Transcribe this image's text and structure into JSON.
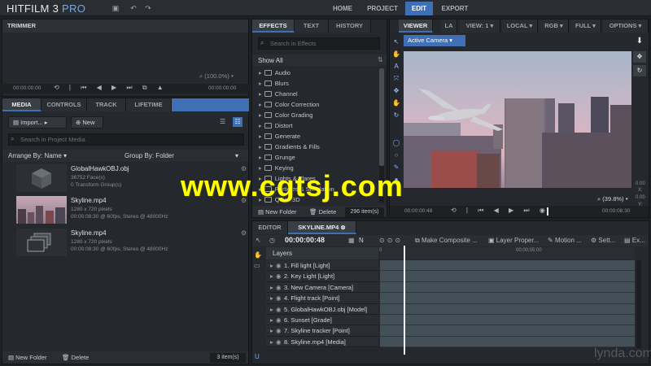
{
  "app": {
    "title": "HITFILM 3",
    "edition": "PRO"
  },
  "nav": {
    "tabs": [
      "HOME",
      "PROJECT",
      "EDIT",
      "EXPORT"
    ],
    "active": "EDIT"
  },
  "trimmer": {
    "title": "TRIMMER",
    "zoom": "(100.0%)",
    "time_start": "00:00:00:00",
    "time_end": "00:00:00:00"
  },
  "media": {
    "tabs": [
      "MEDIA",
      "CONTROLS",
      "TRACK",
      "LIFETIME"
    ],
    "import_label": "Import...",
    "new_label": "New",
    "search_placeholder": "Search in Project Media",
    "arrange_label": "Arrange By: Name",
    "group_label": "Group By: Folder",
    "items": [
      {
        "name": "GlobalHawkOBJ.obj",
        "line1": "36752 Face(s)",
        "line2": "0 Transform Group(s)"
      },
      {
        "name": "Skyline.mp4",
        "line1": "1280 x 720 pixels",
        "line2": "00:00:08:30 @ 60fps, Stereo @ 48000Hz"
      },
      {
        "name": "Skyline.mp4",
        "line1": "1280 x 720 pixels",
        "line2": "00:00:08:30 @ 60fps, Stereo @ 48000Hz"
      }
    ],
    "new_folder": "New Folder",
    "delete": "Delete",
    "count": "3 item(s)"
  },
  "effects": {
    "tabs": [
      "EFFECTS",
      "TEXT",
      "HISTORY"
    ],
    "search_placeholder": "Search in Effects",
    "show_all": "Show All",
    "categories": [
      "Audio",
      "Blurs",
      "Channel",
      "Color Correction",
      "Color Grading",
      "Distort",
      "Generate",
      "Gradients & Fills",
      "Grunge",
      "Keying",
      "Lights & Flares",
      "Particles & Simulation",
      "Quick 3D"
    ],
    "new_folder": "New Folder",
    "delete": "Delete",
    "count": "296 item(s)"
  },
  "viewer": {
    "title": "VIEWER",
    "tab2": "LA",
    "view": "VIEW: 1",
    "space": "LOCAL",
    "color": "RGB",
    "quality": "FULL",
    "options": "OPTIONS",
    "camera": "Active Camera",
    "zoom": "(39.8%)",
    "coord_x_label": "X:",
    "coord_x": "0.00",
    "coord_y_label": "Y:",
    "coord_y": "0.00",
    "time_current": "00:00:00:48",
    "time_end": "00:00:08:30"
  },
  "editor": {
    "tabs": [
      "EDITOR",
      "SKYLINE.MP4"
    ],
    "timecode": "00:00:00:48",
    "tools": [
      "N",
      "Make Composite ...",
      "Layer Proper...",
      "Motion ...",
      "Sett...",
      "Ex..."
    ],
    "ruler": [
      "0",
      "00:00:05:00"
    ],
    "layers_title": "Layers",
    "layers": [
      "1. Fill light [Light]",
      "2. Key Light [Light]",
      "3. New Camera [Camera]",
      "4. Flight track [Point]",
      "5. GlobalHawkOBJ.obj [Model]",
      "6. Sunset [Grade]",
      "7. Skyline tracker [Point]",
      "8. Skyline.mp4 [Media]"
    ]
  },
  "watermark": {
    "text": "www.cgtsj.com",
    "brand": "lynda.com"
  },
  "colors": {
    "accent": "#3f6fb4",
    "background": "#1e2124",
    "panel": "#25282c",
    "watermark": "#ffff00"
  }
}
